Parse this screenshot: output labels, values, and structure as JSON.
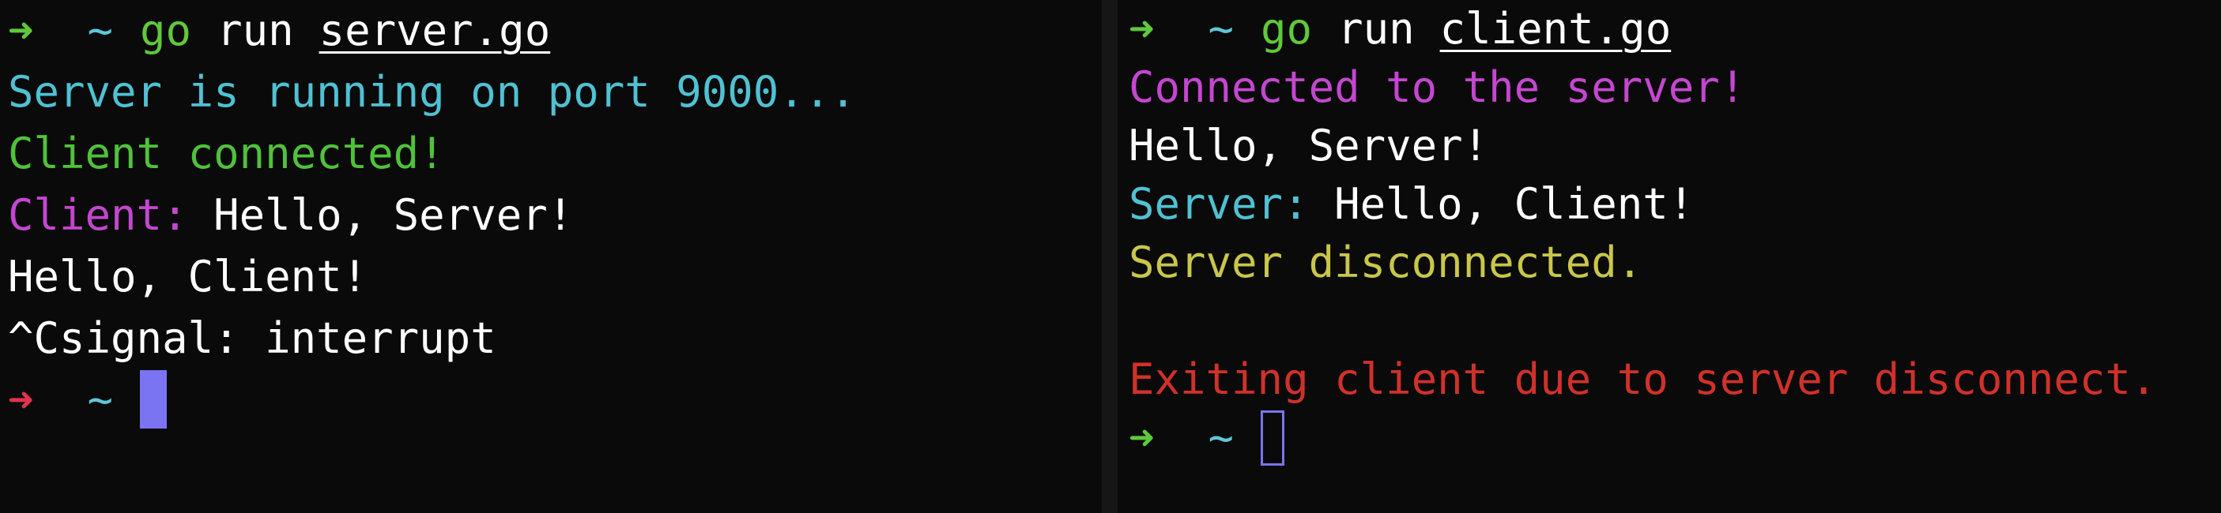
{
  "left_pane": {
    "prompt": {
      "arrow": "➜",
      "tilde": "~",
      "go": "go",
      "run": "run",
      "file": "server.go"
    },
    "lines": {
      "l1": "Server is running on port 9000...",
      "l2": "Client connected!",
      "l3_label": "Client:",
      "l3_text": " Hello, Server!",
      "l4": "Hello, Client!",
      "l5": "^Csignal: interrupt"
    },
    "final_prompt": {
      "arrow": "➜",
      "tilde": "~"
    }
  },
  "right_pane": {
    "prompt": {
      "arrow": "➜",
      "tilde": "~",
      "go": "go",
      "run": "run",
      "file": "client.go"
    },
    "lines": {
      "l1": "Connected to the server!",
      "l2": "Hello, Server!",
      "l3_label": "Server:",
      "l3_text": " Hello, Client!",
      "l4": "Server disconnected.",
      "l5": "",
      "l6": "Exiting client due to server disconnect."
    },
    "final_prompt": {
      "arrow": "➜",
      "tilde": "~"
    }
  },
  "colors": {
    "background": "#0a0a0a",
    "green": "#5fc93a",
    "red_arrow": "#e0344a",
    "cyan": "#4fc1d3",
    "magenta": "#c546d1",
    "yellow": "#c9c64a",
    "error_red": "#d0312a",
    "cursor": "#7b74f2"
  }
}
